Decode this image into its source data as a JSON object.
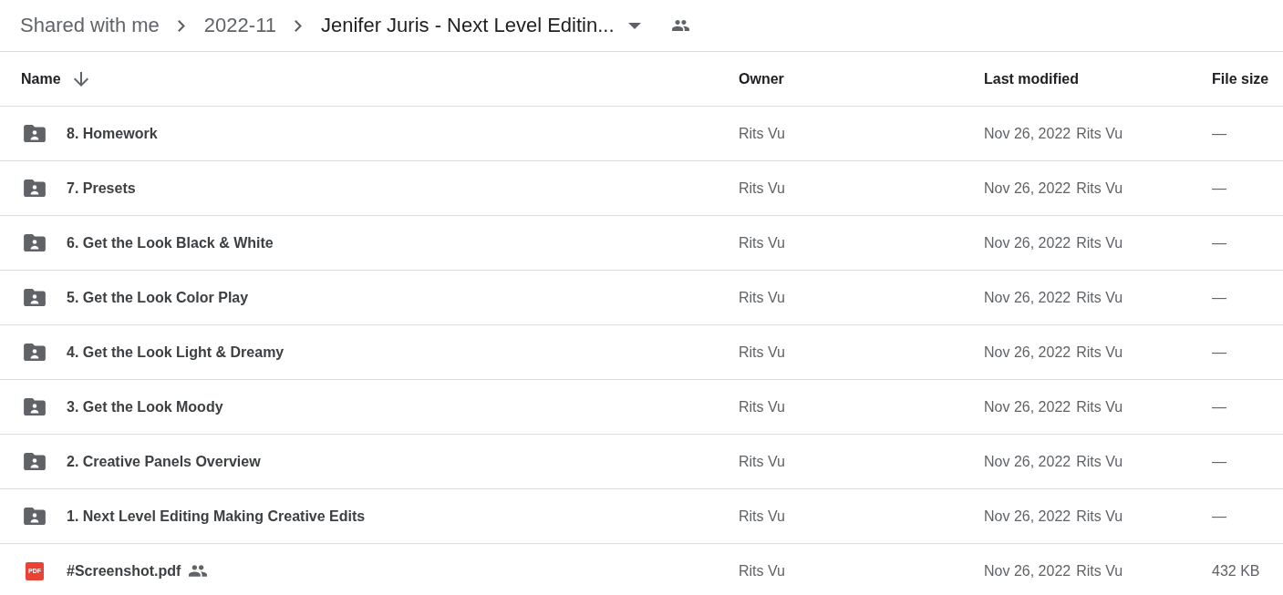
{
  "breadcrumb": {
    "items": [
      {
        "label": "Shared with me",
        "current": false
      },
      {
        "label": "2022-11",
        "current": false
      },
      {
        "label": "Jenifer Juris - Next Level Editin...",
        "current": true
      }
    ],
    "shared": true
  },
  "table": {
    "columns": [
      {
        "label": "Name",
        "sorted": true,
        "descending": true
      },
      {
        "label": "Owner",
        "sorted": false
      },
      {
        "label": "Last modified",
        "sorted": false
      },
      {
        "label": "File size",
        "sorted": false
      }
    ],
    "rows": [
      {
        "kind": "folder",
        "name": "8. Homework",
        "shared": false,
        "owner": "Rits Vu",
        "modified": "Nov 26, 2022",
        "modified_by": "Rits Vu",
        "size": "—"
      },
      {
        "kind": "folder",
        "name": "7. Presets",
        "shared": false,
        "owner": "Rits Vu",
        "modified": "Nov 26, 2022",
        "modified_by": "Rits Vu",
        "size": "—"
      },
      {
        "kind": "folder",
        "name": "6. Get the Look Black & White",
        "shared": false,
        "owner": "Rits Vu",
        "modified": "Nov 26, 2022",
        "modified_by": "Rits Vu",
        "size": "—"
      },
      {
        "kind": "folder",
        "name": "5. Get the Look Color Play",
        "shared": false,
        "owner": "Rits Vu",
        "modified": "Nov 26, 2022",
        "modified_by": "Rits Vu",
        "size": "—"
      },
      {
        "kind": "folder",
        "name": "4. Get the Look Light & Dreamy",
        "shared": false,
        "owner": "Rits Vu",
        "modified": "Nov 26, 2022",
        "modified_by": "Rits Vu",
        "size": "—"
      },
      {
        "kind": "folder",
        "name": "3. Get the Look Moody",
        "shared": false,
        "owner": "Rits Vu",
        "modified": "Nov 26, 2022",
        "modified_by": "Rits Vu",
        "size": "—"
      },
      {
        "kind": "folder",
        "name": "2. Creative Panels Overview",
        "shared": false,
        "owner": "Rits Vu",
        "modified": "Nov 26, 2022",
        "modified_by": "Rits Vu",
        "size": "—"
      },
      {
        "kind": "folder",
        "name": "1. Next Level Editing Making Creative Edits",
        "shared": false,
        "owner": "Rits Vu",
        "modified": "Nov 26, 2022",
        "modified_by": "Rits Vu",
        "size": "—"
      },
      {
        "kind": "pdf",
        "badge": "PDF",
        "name": "#Screenshot.pdf",
        "shared": true,
        "owner": "Rits Vu",
        "modified": "Nov 26, 2022",
        "modified_by": "Rits Vu",
        "size": "432 KB"
      }
    ]
  }
}
